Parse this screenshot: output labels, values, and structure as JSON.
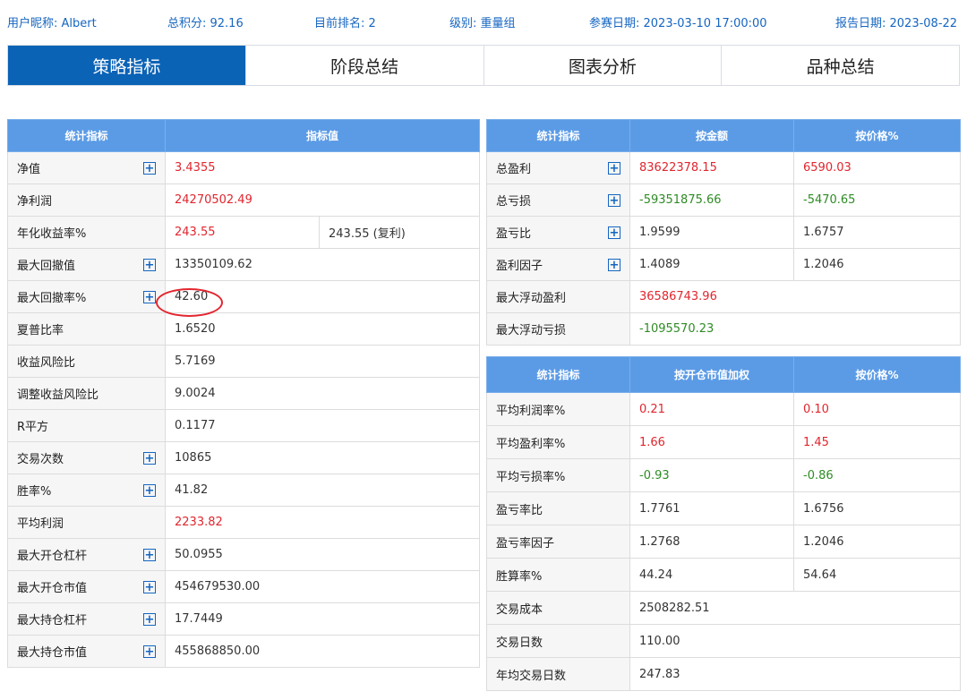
{
  "header": {
    "nickname": "用户昵称: Albert",
    "score": "总积分: 92.16",
    "rank": "目前排名: 2",
    "level_label": "级别: ",
    "level_value": "重量组",
    "start_date": "参赛日期: 2023-03-10 17:00:00",
    "report_date": "报告日期: 2023-08-22"
  },
  "tabs": [
    {
      "label": "策略指标",
      "active": true
    },
    {
      "label": "阶段总结",
      "active": false
    },
    {
      "label": "图表分析",
      "active": false
    },
    {
      "label": "品种总结",
      "active": false
    }
  ],
  "left_table": {
    "headers": [
      "统计指标",
      "指标值"
    ],
    "rows": [
      {
        "label": "净值",
        "plus": true,
        "value": "3.4355",
        "color": "red"
      },
      {
        "label": "净利润",
        "plus": false,
        "value": "24270502.49",
        "color": "red"
      },
      {
        "label": "年化收益率%",
        "plus": false,
        "value": "243.55",
        "color": "red",
        "extra": "243.55 (复利)"
      },
      {
        "label": "最大回撤值",
        "plus": true,
        "value": "13350109.62",
        "color": ""
      },
      {
        "label": "最大回撤率%",
        "plus": true,
        "value": "42.60",
        "color": ""
      },
      {
        "label": "夏普比率",
        "plus": false,
        "value": "1.6520",
        "color": ""
      },
      {
        "label": "收益风险比",
        "plus": false,
        "value": "5.7169",
        "color": ""
      },
      {
        "label": "调整收益风险比",
        "plus": false,
        "value": "9.0024",
        "color": ""
      },
      {
        "label": "R平方",
        "plus": false,
        "value": "0.1177",
        "color": ""
      },
      {
        "label": "交易次数",
        "plus": true,
        "value": "10865",
        "color": ""
      },
      {
        "label": "胜率%",
        "plus": true,
        "value": "41.82",
        "color": ""
      },
      {
        "label": "平均利润",
        "plus": false,
        "value": "2233.82",
        "color": "red"
      },
      {
        "label": "最大开仓杠杆",
        "plus": true,
        "value": "50.0955",
        "color": ""
      },
      {
        "label": "最大开仓市值",
        "plus": true,
        "value": "454679530.00",
        "color": ""
      },
      {
        "label": "最大持仓杠杆",
        "plus": true,
        "value": "17.7449",
        "color": ""
      },
      {
        "label": "最大持仓市值",
        "plus": true,
        "value": "455868850.00",
        "color": ""
      }
    ]
  },
  "right_top": {
    "headers": [
      "统计指标",
      "按金额",
      "按价格%"
    ],
    "rows": [
      {
        "label": "总盈利",
        "plus": true,
        "v1": "83622378.15",
        "c1": "red",
        "v2": "6590.03",
        "c2": "red"
      },
      {
        "label": "总亏损",
        "plus": true,
        "v1": "-59351875.66",
        "c1": "green",
        "v2": "-5470.65",
        "c2": "green"
      },
      {
        "label": "盈亏比",
        "plus": true,
        "v1": "1.9599",
        "c1": "",
        "v2": "1.6757",
        "c2": ""
      },
      {
        "label": "盈利因子",
        "plus": true,
        "v1": "1.4089",
        "c1": "",
        "v2": "1.2046",
        "c2": ""
      },
      {
        "label": "最大浮动盈利",
        "plus": false,
        "v1": "36586743.96",
        "c1": "red",
        "v2": null,
        "c2": ""
      },
      {
        "label": "最大浮动亏损",
        "plus": false,
        "v1": "-1095570.23",
        "c1": "green",
        "v2": null,
        "c2": ""
      }
    ]
  },
  "right_bottom": {
    "headers": [
      "统计指标",
      "按开仓市值加权",
      "按价格%"
    ],
    "rows": [
      {
        "label": "平均利润率%",
        "v1": "0.21",
        "c1": "red",
        "v2": "0.10",
        "c2": "red"
      },
      {
        "label": "平均盈利率%",
        "v1": "1.66",
        "c1": "red",
        "v2": "1.45",
        "c2": "red"
      },
      {
        "label": "平均亏损率%",
        "v1": "-0.93",
        "c1": "green",
        "v2": "-0.86",
        "c2": "green"
      },
      {
        "label": "盈亏率比",
        "v1": "1.7761",
        "c1": "",
        "v2": "1.6756",
        "c2": ""
      },
      {
        "label": "盈亏率因子",
        "v1": "1.2768",
        "c1": "",
        "v2": "1.2046",
        "c2": ""
      },
      {
        "label": "胜算率%",
        "v1": "44.24",
        "c1": "",
        "v2": "54.64",
        "c2": ""
      },
      {
        "label": "交易成本",
        "v1": "2508282.51",
        "c1": "",
        "v2": null,
        "c2": ""
      },
      {
        "label": "交易日数",
        "v1": "110.00",
        "c1": "",
        "v2": null,
        "c2": ""
      },
      {
        "label": "年均交易日数",
        "v1": "247.83",
        "c1": "",
        "v2": null,
        "c2": ""
      }
    ]
  },
  "colors": {
    "accent": "#0b63b6",
    "header_bg": "#5b9be6",
    "positive": "#e0262e",
    "negative": "#2e8b24"
  },
  "plus_symbol": "+"
}
